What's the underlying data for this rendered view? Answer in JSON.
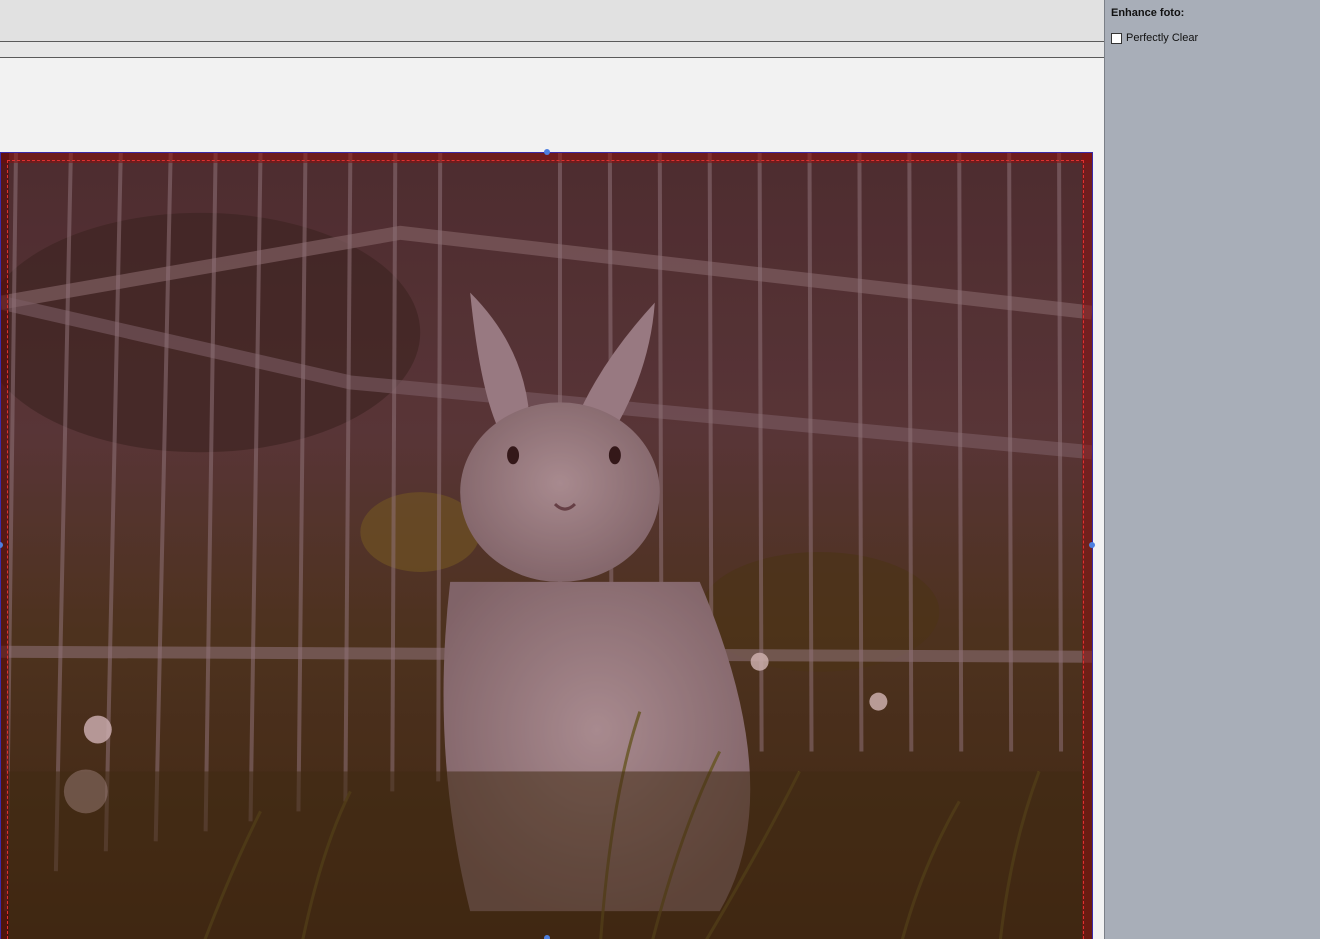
{
  "side_panel": {
    "title": "Enhance foto:",
    "options": [
      {
        "label": "Perfectly Clear",
        "checked": false
      }
    ]
  },
  "canvas": {
    "image_subject": "rabbit-photo",
    "bleed_color": "#e03030",
    "frame_color": "#3b2aa8",
    "overlay_color": "#8b1010"
  }
}
